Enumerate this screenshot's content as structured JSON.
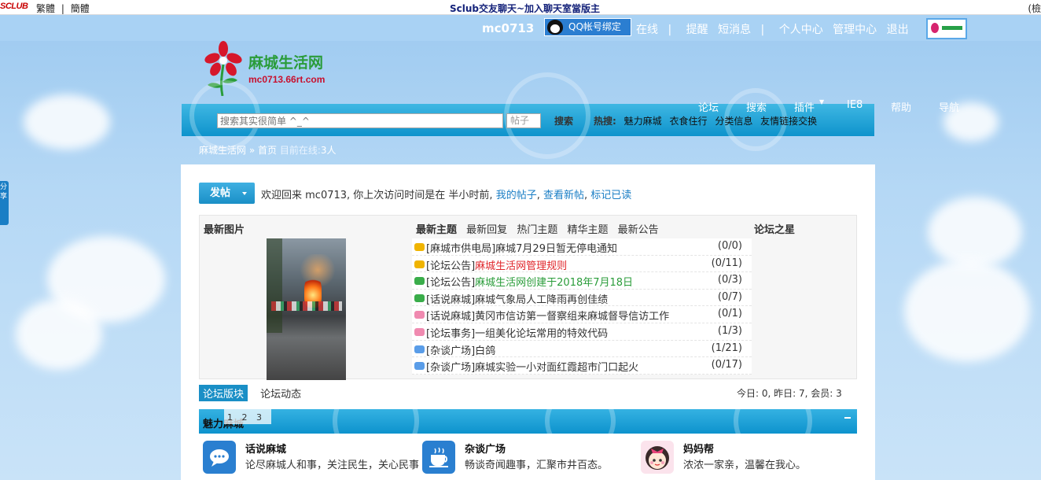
{
  "topstrip": {
    "logo": "SCLUB",
    "lang_traditional": "繁體",
    "lang_sep": "|",
    "lang_simplified": "簡體",
    "headline": "Sclub交友聊天~加入聊天室當版主",
    "right_text": "(檢"
  },
  "userbar": {
    "username": "mc0713",
    "qq_bind": "QQ帐号绑定",
    "online": "在线",
    "sep1": "|",
    "remind": "提醒",
    "sms": "短消息",
    "sep2": "|",
    "profile": "个人中心",
    "admin": "管理中心",
    "logout": "退出"
  },
  "site": {
    "name": "麻城生活网",
    "domain": "mc0713.66rt.com"
  },
  "nav": {
    "menu": [
      "论坛",
      "搜索",
      "插件",
      "IE8",
      "帮助",
      "导航"
    ],
    "search_placeholder": "搜索其实很简单 ^_^",
    "search_type": "帖子",
    "search_button": "搜索",
    "hot_label": "热搜:",
    "hot_links": [
      "魅力麻城",
      "衣食住行",
      "分类信息",
      "友情链接交换"
    ]
  },
  "breadcrumb": {
    "site": "麻城生活网",
    "sep": "»",
    "home": "首页",
    "online_label": "目前在线:",
    "online_count": "3",
    "online_unit": "人"
  },
  "toolbar": {
    "post_label": "发帖",
    "welcome_prefix": "欢迎回来 mc0713, 你上次访问时间是在 半小时前,",
    "my_posts": "我的帖子",
    "comma1": ",",
    "new_posts": "查看新帖",
    "comma2": ",",
    "mark_read": "标记已读"
  },
  "box": {
    "latest_images": "最新图片",
    "tabs": [
      "最新主题",
      "最新回复",
      "热门主题",
      "精华主题",
      "最新公告"
    ],
    "forum_star": "论坛之星",
    "threads": [
      {
        "prefix": "[麻城市供电局]",
        "title": "麻城7月29日暂无停电通知",
        "count": "(0/0)",
        "title_color": "#333333",
        "icon_color": "#f0b400"
      },
      {
        "prefix": "[论坛公告]",
        "title": "麻城生活网管理规则",
        "count": "(0/11)",
        "title_color": "#e0262b",
        "icon_color": "#f0b400"
      },
      {
        "prefix": "[论坛公告]",
        "title": "麻城生活网创建于2018年7月18日",
        "count": "(0/3)",
        "title_color": "#2a9c3a",
        "icon_color": "#3aad4a"
      },
      {
        "prefix": "[话说麻城]",
        "title": "麻城气象局人工降雨再创佳绩",
        "count": "(0/7)",
        "title_color": "#333333",
        "icon_color": "#3aad4a"
      },
      {
        "prefix": "[话说麻城]",
        "title": "黄冈市信访第一督察组来麻城督导信访工作",
        "count": "(0/1)",
        "title_color": "#333333",
        "icon_color": "#f08ab0"
      },
      {
        "prefix": "[论坛事务]",
        "title": "一组美化论坛常用的特效代码",
        "count": "(1/3)",
        "title_color": "#333333",
        "icon_color": "#f08ab0"
      },
      {
        "prefix": "[杂谈广场]",
        "title": "白鸽",
        "count": "(1/21)",
        "title_color": "#333333",
        "icon_color": "#5a9de8"
      },
      {
        "prefix": "[杂谈广场]",
        "title": "麻城实验一小对面红霞超市门口起火",
        "count": "(0/17)",
        "title_color": "#333333",
        "icon_color": "#5a9de8"
      }
    ]
  },
  "lower": {
    "tab_boards": "论坛版块",
    "tab_activity": "论坛动态",
    "stats": "今日: 0, 昨日: 7, 会员: 3"
  },
  "category": {
    "title": "魅力麻城",
    "pages": [
      "1",
      "2",
      "3"
    ]
  },
  "forums": [
    {
      "name": "话说麻城",
      "desc": "论尽麻城人和事，关注民生，关心民事",
      "icon": "chat-bubble-icon",
      "color": "#2a7fd0"
    },
    {
      "name": "杂谈广场",
      "desc": "畅谈奇闻趣事，汇聚市井百态。",
      "icon": "coffee-cup-icon",
      "color": "#2a7fd0"
    },
    {
      "name": "妈妈帮",
      "desc": "浓浓一家亲，温馨在我心。",
      "icon": "girl-face-icon",
      "color": "#f4a6c4"
    }
  ],
  "share_tab": "分享"
}
